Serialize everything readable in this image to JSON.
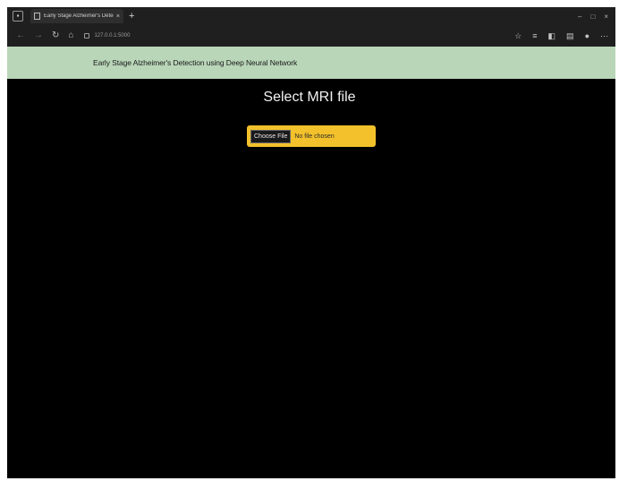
{
  "browser": {
    "tab_title": "Early Stage Alzheimer's Detection u",
    "tab_close": "×",
    "new_tab": "+",
    "address": "127.0.0.1:5000",
    "window_controls": [
      "–",
      "□",
      "×"
    ],
    "nav_icons": [
      "back-icon",
      "forward-icon",
      "refresh-icon",
      "home-icon"
    ],
    "toolbar_icons": [
      "favorite-icon",
      "reading-icon",
      "extensions-icon",
      "collections-icon",
      "profile-icon",
      "settings-icon"
    ]
  },
  "header": {
    "title": "Early Stage Alzheimer's Detection using Deep Neural Network",
    "background": "#b9d6b8"
  },
  "main": {
    "heading": "Select MRI file",
    "file_input": {
      "button_label": "Choose File",
      "status": "No file chosen",
      "background": "#f3c12b"
    }
  }
}
